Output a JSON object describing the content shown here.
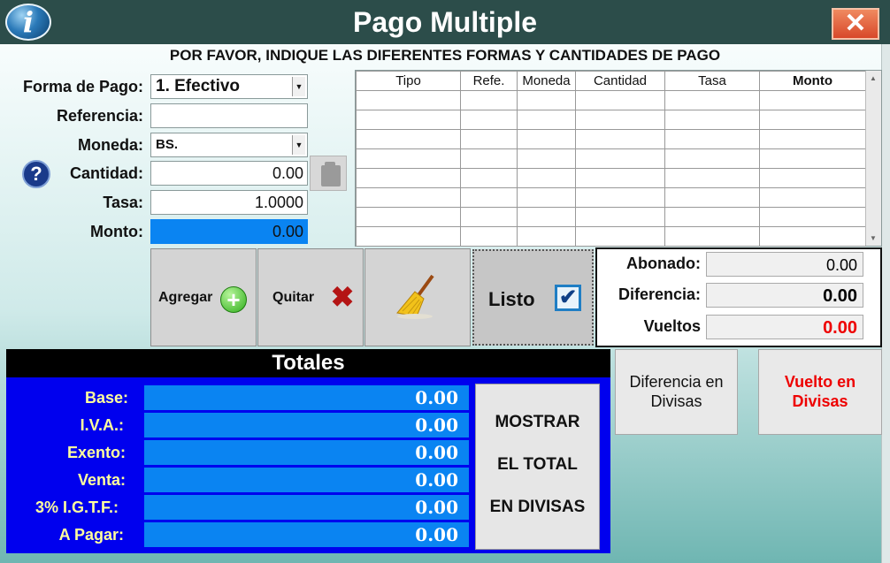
{
  "window": {
    "title": "Pago Multiple",
    "info_icon": "i",
    "close_icon": "✕",
    "subtitle": "POR FAVOR, INDIQUE LAS DIFERENTES FORMAS Y CANTIDADES DE PAGO"
  },
  "form": {
    "forma_label": "Forma de Pago:",
    "forma_value": "1. Efectivo",
    "referencia_label": "Referencia:",
    "referencia_value": "",
    "moneda_label": "Moneda:",
    "moneda_value": "BS.",
    "cantidad_label": "Cantidad:",
    "cantidad_value": "0.00",
    "tasa_label": "Tasa:",
    "tasa_value": "1.0000",
    "monto_label": "Monto:",
    "monto_value": "0.00"
  },
  "grid": {
    "columns": [
      "Tipo",
      "Refe.",
      "Moneda",
      "Cantidad",
      "Tasa",
      "Monto"
    ]
  },
  "actions": {
    "agregar": "Agregar",
    "quitar": "Quitar",
    "listo": "Listo"
  },
  "summary": {
    "abonado_label": "Abonado:",
    "abonado_value": "0.00",
    "diferencia_label": "Diferencia:",
    "diferencia_value": "0.00",
    "vueltos_label": "Vueltos",
    "vueltos_value": "0.00"
  },
  "totales": {
    "title": "Totales",
    "base_label": "Base:",
    "base_value": "0.00",
    "iva_label": "I.V.A.:",
    "iva_value": "0.00",
    "exento_label": "Exento:",
    "exento_value": "0.00",
    "venta_label": "Venta:",
    "venta_value": "0.00",
    "igtf_label": "3% I.G.T.F.:",
    "igtf_value": "0.00",
    "apagar_label": "A Pagar:",
    "apagar_value": "0.00",
    "mostrar_line1": "MOSTRAR",
    "mostrar_line2": "EL TOTAL",
    "mostrar_line3": "EN DIVISAS"
  },
  "divisas": {
    "diferencia_line1": "Diferencia en",
    "diferencia_line2": "Divisas",
    "vuelto_line1": "Vuelto en",
    "vuelto_line2": "Divisas"
  },
  "colors": {
    "titlebar": "#2c4d4a",
    "monto_highlight": "#0a84f2",
    "totales_panel": "#0000ee",
    "totales_labels": "#ffff9e",
    "vueltos_red": "#ee0000",
    "help_icon": "#1a3a8a"
  }
}
